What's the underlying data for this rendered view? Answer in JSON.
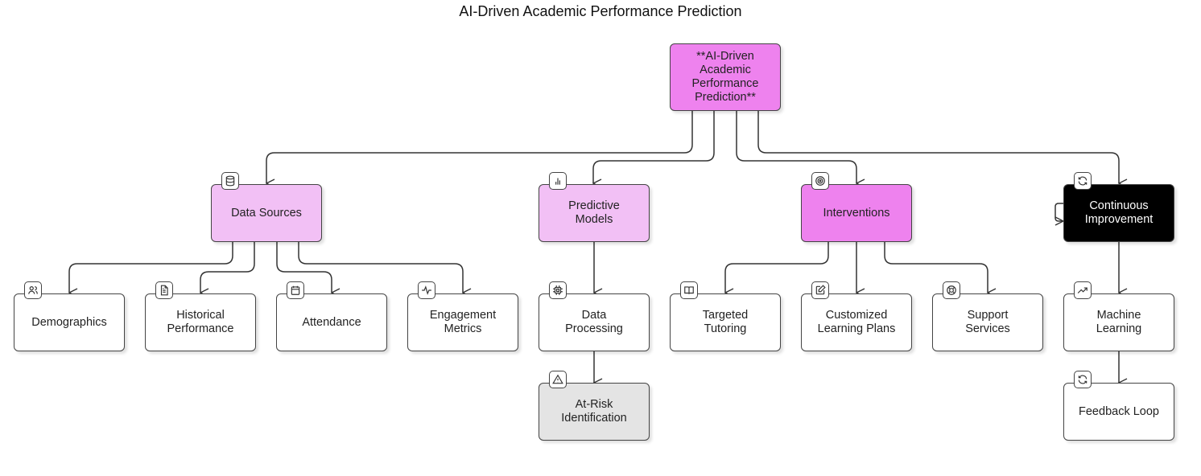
{
  "title": "AI-Driven Academic Performance Prediction",
  "colors": {
    "root": "#ee82ee",
    "category_light": "#f2c0f5",
    "interventions": "#ee82ee",
    "continuous": "#000000",
    "leaf": "#ffffff",
    "at_risk": "#e4e4e4",
    "stroke": "#444444"
  },
  "root": {
    "label": "**AI-Driven Academic Performance Prediction**"
  },
  "categories": [
    {
      "id": "data-sources",
      "label": "Data Sources",
      "icon": "database-icon"
    },
    {
      "id": "predictive-models",
      "label": "Predictive Models",
      "icon": "bar-chart-icon"
    },
    {
      "id": "interventions",
      "label": "Interventions",
      "icon": "target-icon"
    },
    {
      "id": "continuous-improvement",
      "label": "Continuous Improvement",
      "icon": "refresh-icon"
    }
  ],
  "leaves": [
    {
      "id": "demographics",
      "label": "Demographics",
      "icon": "users-icon",
      "parent": "data-sources"
    },
    {
      "id": "historical-performance",
      "label": "Historical Performance",
      "icon": "document-icon",
      "parent": "data-sources"
    },
    {
      "id": "attendance",
      "label": "Attendance",
      "icon": "calendar-icon",
      "parent": "data-sources"
    },
    {
      "id": "engagement-metrics",
      "label": "Engagement Metrics",
      "icon": "activity-icon",
      "parent": "data-sources"
    },
    {
      "id": "data-processing",
      "label": "Data Processing",
      "icon": "cpu-icon",
      "parent": "predictive-models"
    },
    {
      "id": "at-risk-identification",
      "label": "At-Risk Identification",
      "icon": "warning-icon",
      "parent": "data-processing"
    },
    {
      "id": "targeted-tutoring",
      "label": "Targeted Tutoring",
      "icon": "book-icon",
      "parent": "interventions"
    },
    {
      "id": "customized-learning-plans",
      "label": "Customized Learning Plans",
      "icon": "edit-icon",
      "parent": "interventions"
    },
    {
      "id": "support-services",
      "label": "Support Services",
      "icon": "lifebuoy-icon",
      "parent": "interventions"
    },
    {
      "id": "machine-learning",
      "label": "Machine Learning",
      "icon": "trending-up-icon",
      "parent": "continuous-improvement"
    },
    {
      "id": "feedback-loop",
      "label": "Feedback Loop",
      "icon": "refresh-icon",
      "parent": "machine-learning"
    }
  ]
}
